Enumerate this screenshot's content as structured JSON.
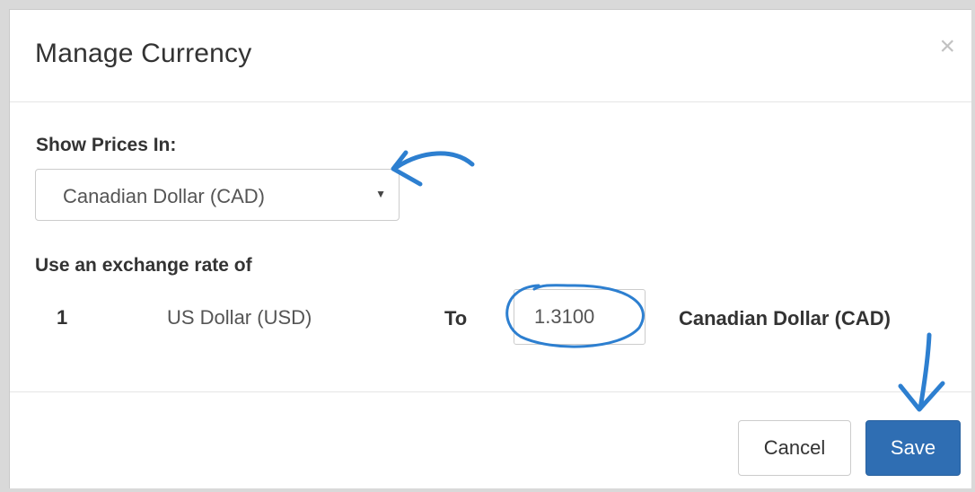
{
  "modal": {
    "title": "Manage Currency",
    "close_label": "×"
  },
  "currency_select": {
    "label": "Show Prices In:",
    "selected_value": "Canadian Dollar (CAD)",
    "caret": "▼"
  },
  "exchange_rate": {
    "label": "Use an exchange rate of",
    "amount": "1",
    "from_currency": "US Dollar (USD)",
    "to_label": "To",
    "rate_value": "1.3100",
    "to_currency": "Canadian Dollar (CAD)"
  },
  "footer": {
    "cancel_label": "Cancel",
    "save_label": "Save"
  },
  "colors": {
    "primary_button": "#2f6eb3",
    "annotation_ink": "#2d7fd0"
  },
  "annotations": [
    "arrow-to-currency-select",
    "circle-around-rate-input",
    "arrow-to-save-button"
  ]
}
